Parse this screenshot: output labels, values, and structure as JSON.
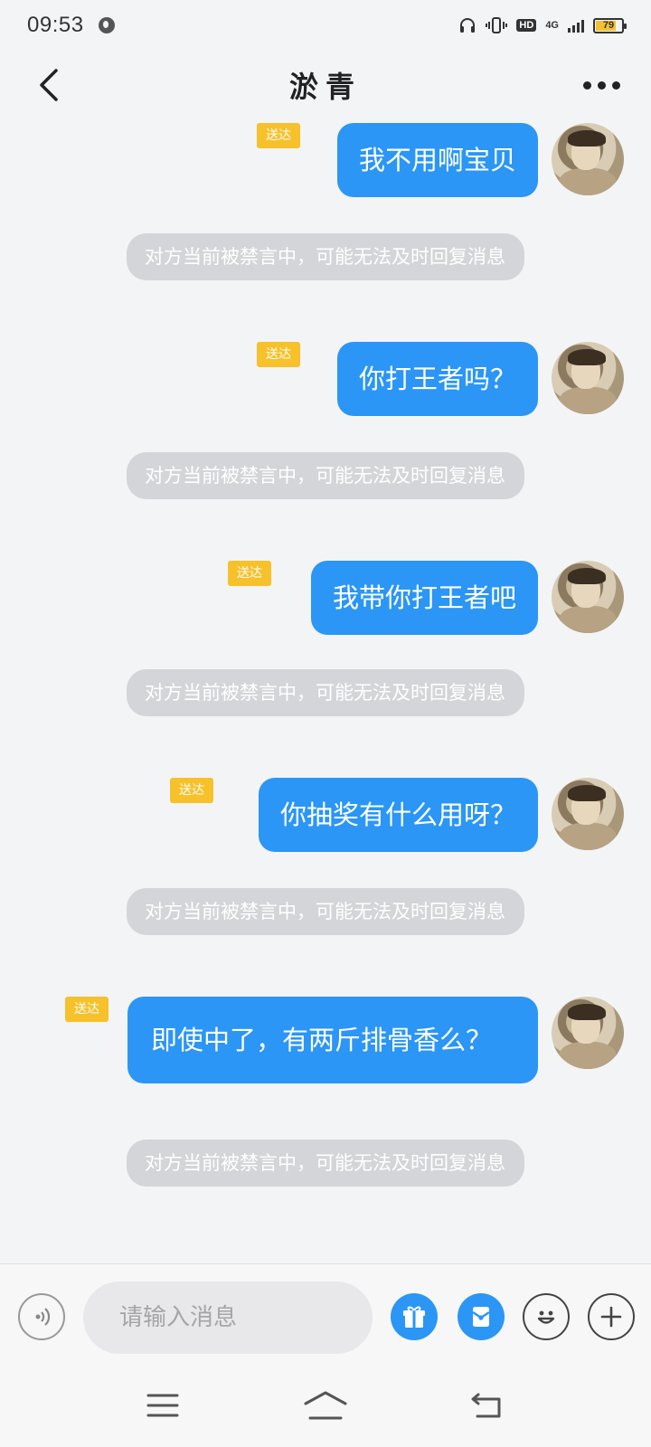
{
  "status": {
    "time": "09:53",
    "hd": "HD",
    "network": "4G",
    "battery": "79",
    "battery_level": 0.79,
    "battery_color": "#f6c12a"
  },
  "header": {
    "title": "淤青"
  },
  "colors": {
    "bubble_out": "#2b96f5",
    "notice_bg": "#d4d5d8",
    "sent_tag": "#f6c12a"
  },
  "messages": [
    {
      "text": "我不用啊宝贝",
      "tag": "送达"
    },
    {
      "text": "对方当前被禁言中，可能无法及时回复消息"
    },
    {
      "text": "你打王者吗？",
      "tag": "送达"
    },
    {
      "text": "对方当前被禁言中，可能无法及时回复消息"
    },
    {
      "text": "我带你打王者吧",
      "tag": "送达"
    },
    {
      "text": "对方当前被禁言中，可能无法及时回复消息"
    },
    {
      "text": "你抽奖有什么用呀？",
      "tag": "送达"
    },
    {
      "text": "对方当前被禁言中，可能无法及时回复消息"
    },
    {
      "text": "即使中了，有两斤排骨香么？",
      "tag": "送达"
    },
    {
      "text": "对方当前被禁言中，可能无法及时回复消息"
    }
  ],
  "input": {
    "placeholder": "请输入消息"
  },
  "icons": {
    "voice": "voice-icon",
    "gift": "gift-icon",
    "red_packet": "red-packet-icon",
    "emoji": "emoji-icon",
    "plus": "plus-icon",
    "menu": "menu-icon",
    "home": "home-icon",
    "back": "back-icon"
  }
}
